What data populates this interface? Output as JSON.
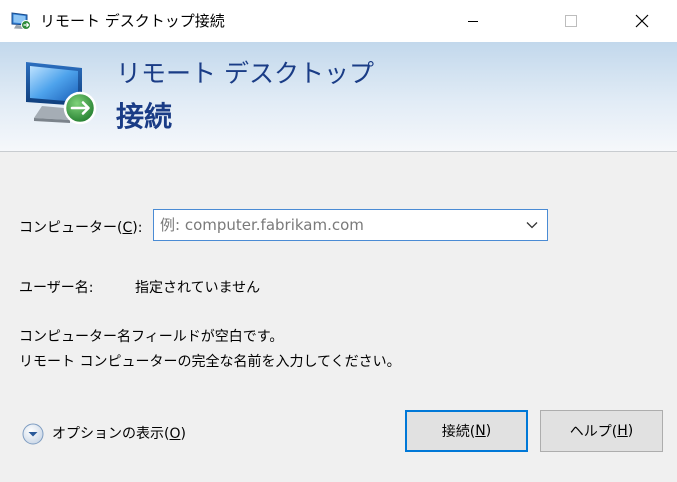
{
  "window": {
    "title": "リモート デスクトップ接続",
    "icon": "remote-desktop-icon",
    "controls": {
      "minimize": "minimize-icon",
      "maximize": "maximize-icon",
      "close": "close-icon"
    }
  },
  "banner": {
    "line1": "リモート デスクトップ",
    "line2": "接続",
    "icon": "remote-desktop-icon"
  },
  "form": {
    "computer": {
      "label_prefix": "コンピューター(",
      "label_key": "C",
      "label_suffix": "):",
      "placeholder": "例: computer.fabrikam.com",
      "value": ""
    },
    "user": {
      "label": "ユーザー名:",
      "value": "指定されていません"
    },
    "message": {
      "line1": "コンピューター名フィールドが空白です。",
      "line2": "リモート コンピューターの完全な名前を入力してください。"
    }
  },
  "options": {
    "label_prefix": "オプションの表示(",
    "label_key": "O",
    "label_suffix": ")",
    "icon": "chevron-down-circle-icon"
  },
  "buttons": {
    "connect": {
      "prefix": "接続(",
      "key": "N",
      "suffix": ")"
    },
    "help": {
      "prefix": "ヘルプ(",
      "key": "H",
      "suffix": ")"
    }
  },
  "colors": {
    "accent": "#0078d7",
    "banner_text": "#1a3c86",
    "banner_top": "#c2d8ec",
    "banner_bottom": "#f6f8fb"
  }
}
